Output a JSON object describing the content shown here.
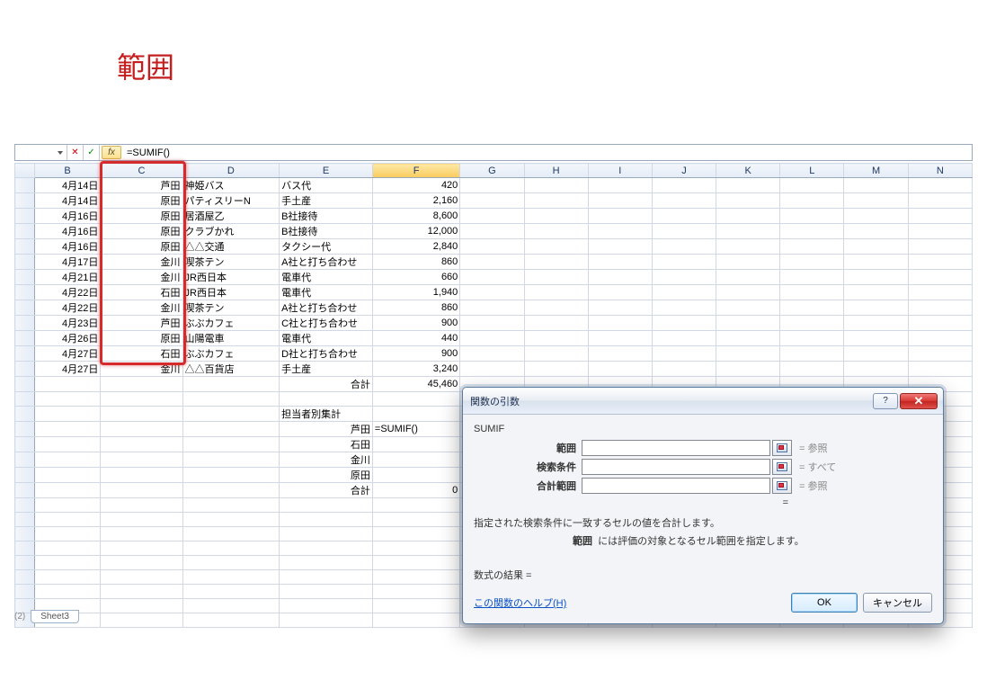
{
  "annotation": "範囲",
  "namebox": "",
  "formula": "=SUMIF()",
  "columns": [
    "B",
    "C",
    "D",
    "E",
    "F",
    "G",
    "H",
    "I",
    "J",
    "K",
    "L",
    "M",
    "N"
  ],
  "rows": [
    {
      "b": "4月14日",
      "c": "芦田",
      "d": "神姫バス",
      "e": "バス代",
      "f": "420"
    },
    {
      "b": "4月14日",
      "c": "原田",
      "d": "パティスリーN",
      "e": "手土産",
      "f": "2,160"
    },
    {
      "b": "4月16日",
      "c": "原田",
      "d": "居酒屋乙",
      "e": "B社接待",
      "f": "8,600"
    },
    {
      "b": "4月16日",
      "c": "原田",
      "d": "クラブかれ",
      "e": "B社接待",
      "f": "12,000"
    },
    {
      "b": "4月16日",
      "c": "原田",
      "d": "△△交通",
      "e": "タクシー代",
      "f": "2,840"
    },
    {
      "b": "4月17日",
      "c": "金川",
      "d": "喫茶テン",
      "e": "A社と打ち合わせ",
      "f": "860"
    },
    {
      "b": "4月21日",
      "c": "金川",
      "d": "JR西日本",
      "e": "電車代",
      "f": "660"
    },
    {
      "b": "4月22日",
      "c": "石田",
      "d": "JR西日本",
      "e": "電車代",
      "f": "1,940"
    },
    {
      "b": "4月22日",
      "c": "金川",
      "d": "喫茶テン",
      "e": "A社と打ち合わせ",
      "f": "860"
    },
    {
      "b": "4月23日",
      "c": "芦田",
      "d": "ぶぶカフェ",
      "e": "C社と打ち合わせ",
      "f": "900"
    },
    {
      "b": "4月26日",
      "c": "原田",
      "d": "山陽電車",
      "e": "電車代",
      "f": "440"
    },
    {
      "b": "4月27日",
      "c": "石田",
      "d": "ぶぶカフェ",
      "e": "D社と打ち合わせ",
      "f": "900"
    },
    {
      "b": "4月27日",
      "c": "金川",
      "d": "△△百貨店",
      "e": "手土産",
      "f": "3,240"
    }
  ],
  "total_label": "合計",
  "total_value": "45,460",
  "summary_title": "担当者別集計",
  "summary_rows": [
    {
      "name": "芦田",
      "val": "=SUMIF()"
    },
    {
      "name": "石田",
      "val": ""
    },
    {
      "name": "金川",
      "val": ""
    },
    {
      "name": "原田",
      "val": ""
    },
    {
      "name": "合計",
      "val": "0"
    }
  ],
  "dialog": {
    "title": "関数の引数",
    "func": "SUMIF",
    "args": [
      {
        "label": "範囲",
        "hint": "= 参照"
      },
      {
        "label": "検索条件",
        "hint": "= すべて"
      },
      {
        "label": "合計範囲",
        "hint": "= 参照"
      }
    ],
    "eq": "=",
    "desc_main": "指定された検索条件に一致するセルの値を合計します。",
    "desc_sub": "範囲  には評価の対象となるセル範囲を指定します。",
    "desc_sub_label": "範囲",
    "result": "数式の結果 =",
    "help": "この関数のヘルプ(H)",
    "ok": "OK",
    "cancel": "キャンセル",
    "help_btn": "?",
    "close_btn": "✕"
  },
  "sheet_info": "(2)",
  "sheet_tab": "Sheet3"
}
